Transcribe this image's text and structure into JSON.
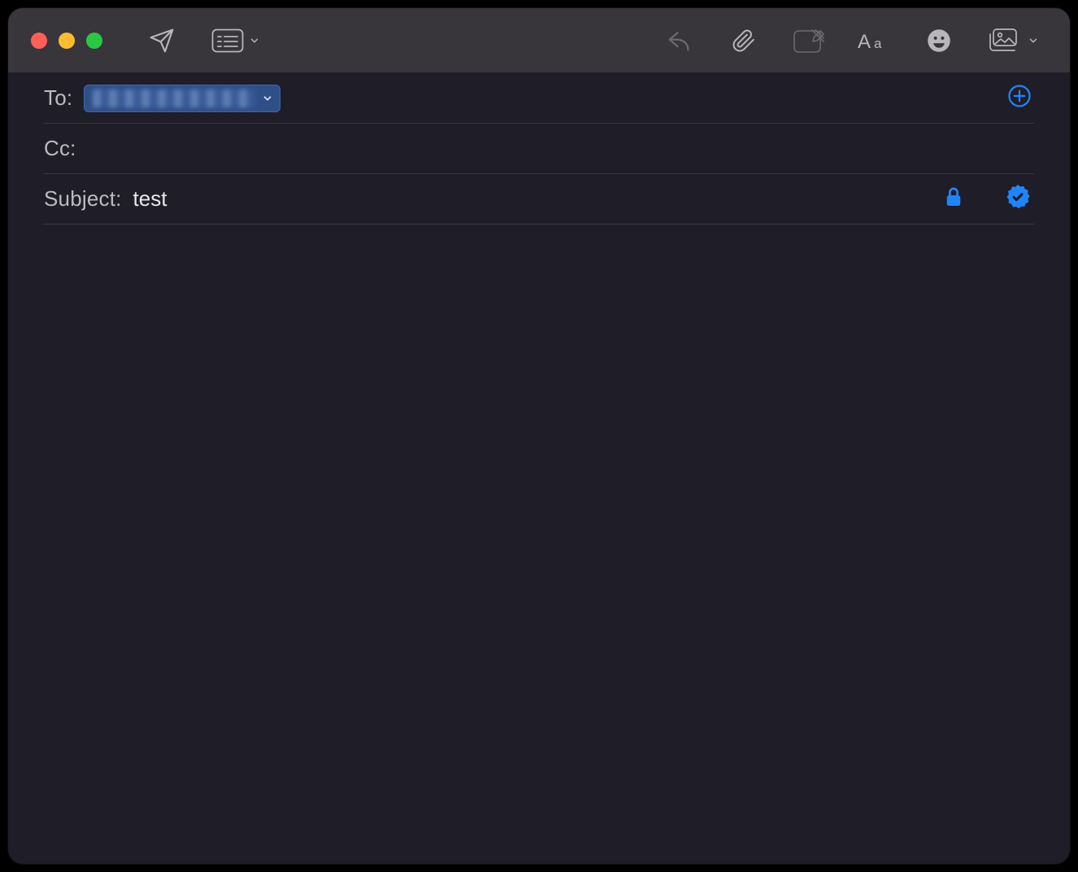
{
  "toolbar": {
    "icons": {
      "send": "send-icon",
      "header_fields": "header-fields-icon",
      "reply": "reply-icon",
      "attach": "paperclip-icon",
      "markup": "markup-icon",
      "format": "text-format-icon",
      "emoji": "emoji-icon",
      "media": "photo-browser-icon"
    }
  },
  "fields": {
    "to_label": "To:",
    "to_recipient_redacted": true,
    "cc_label": "Cc:",
    "subject_label": "Subject:",
    "subject_value": "test"
  },
  "security": {
    "encrypted": true,
    "signed": true
  },
  "body": {
    "content": ""
  },
  "colors": {
    "accent_blue": "#1f85ff",
    "chip_bg": "#2e4f87",
    "window_bg": "#1f1d27",
    "titlebar_bg": "#38353b"
  }
}
